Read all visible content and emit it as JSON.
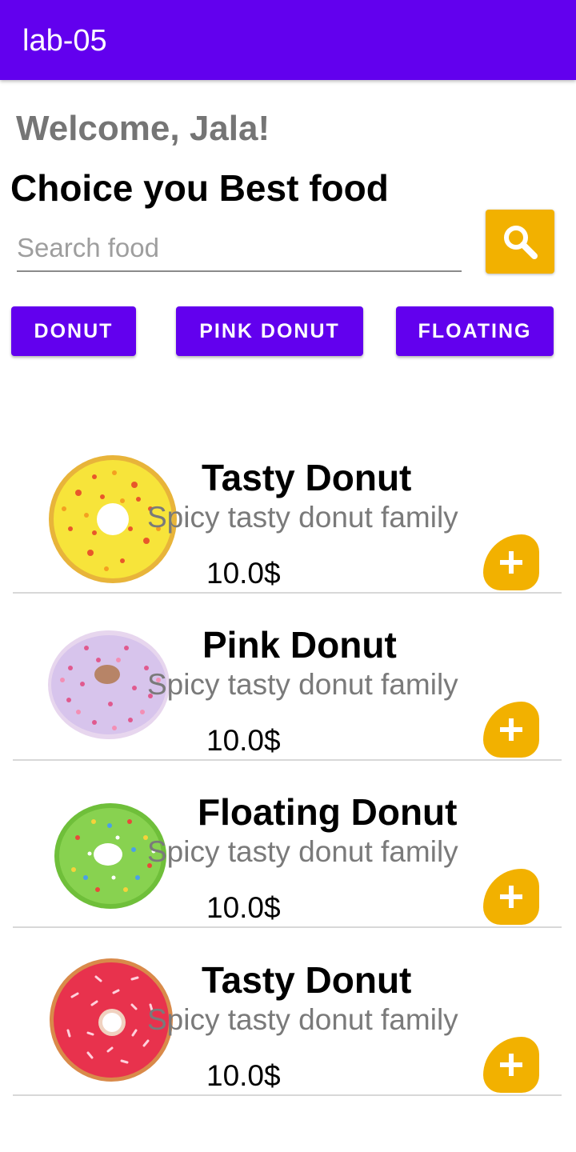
{
  "appbar": {
    "title": "lab-05",
    "color": "#6200ee"
  },
  "header": {
    "welcome": "Welcome, Jala!",
    "subtitle": "Choice you Best food"
  },
  "search": {
    "placeholder": "Search food",
    "button_icon": "search-icon",
    "button_color": "#f2b100"
  },
  "chips": [
    {
      "label": "DONUT"
    },
    {
      "label": "PINK DONUT"
    },
    {
      "label": "FLOATING"
    }
  ],
  "foods": [
    {
      "name": "Tasty Donut",
      "description": "Spicy tasty donut family",
      "price": "10.0$",
      "image": "yellow-sprinkle-donut",
      "add_icon": "plus-icon"
    },
    {
      "name": "Pink Donut",
      "description": "Spicy tasty donut family",
      "price": "10.0$",
      "image": "pink-sprinkle-donut",
      "add_icon": "plus-icon"
    },
    {
      "name": "Floating Donut",
      "description": "Spicy tasty donut family",
      "price": "10.0$",
      "image": "green-sprinkle-donut",
      "add_icon": "plus-icon"
    },
    {
      "name": "Tasty Donut",
      "description": "Spicy tasty donut family",
      "price": "10.0$",
      "image": "red-sprinkle-donut",
      "add_icon": "plus-icon"
    }
  ]
}
